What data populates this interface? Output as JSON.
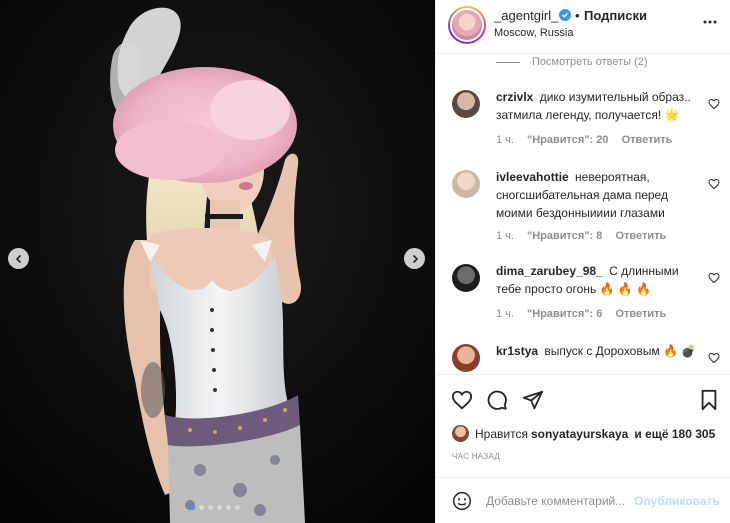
{
  "post": {
    "username": "_agentgirl_",
    "follow_label": "Подписки",
    "bullet": "•",
    "location": "Moscow, Russia",
    "time_label": "ЧАС НАЗАД",
    "slide_count": 6,
    "active_slide": 0
  },
  "view_replies": "Посмотреть ответы (2)",
  "comments": [
    {
      "author": "crzivlx",
      "text": "дико изумительный образ.. затмила легенду, получается! 🌟",
      "time": "1 ч.",
      "likes": "\"Нравится\": 20",
      "reply": "Ответить"
    },
    {
      "author": "ivleevahottie",
      "text": "невероятная, сногсшибательная дама перед моими бездонныииии глазами",
      "time": "1 ч.",
      "likes": "\"Нравится\": 8",
      "reply": "Ответить"
    },
    {
      "author": "dima_zarubey_98_",
      "text": "С длинными тебе просто огонь 🔥 🔥 🔥",
      "time": "1 ч.",
      "likes": "\"Нравится\": 6",
      "reply": "Ответить"
    },
    {
      "author": "kr1stya",
      "text": "выпуск с Дороховым 🔥 💣"
    }
  ],
  "likes_line": {
    "prefix": "Нравится",
    "user": "sonyatayurskaya",
    "suffix": "и ещё 180 305"
  },
  "add_comment": {
    "placeholder": "Добавьте комментарий...",
    "publish": "Опубликовать"
  },
  "colors": {
    "accent": "#3897f0",
    "publish_disabled": "#b2dffc",
    "muted": "#8e8e8e"
  },
  "icons": [
    "chevron-left-icon",
    "chevron-right-icon",
    "verified-icon",
    "more-icon",
    "heart-icon",
    "comment-icon",
    "share-icon",
    "bookmark-icon",
    "emoji-icon"
  ]
}
